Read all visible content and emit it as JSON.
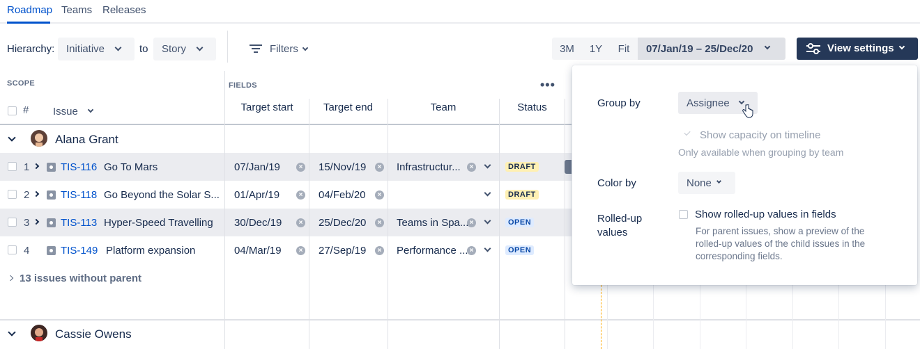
{
  "tabs": [
    {
      "label": "Roadmap",
      "active": true
    },
    {
      "label": "Teams",
      "active": false
    },
    {
      "label": "Releases",
      "active": false
    }
  ],
  "toolbar": {
    "hierarchy_label": "Hierarchy:",
    "from_value": "Initiative",
    "to_label": "to",
    "to_value": "Story",
    "filters_label": "Filters",
    "zoom_3m": "3M",
    "zoom_1y": "1Y",
    "zoom_fit": "Fit",
    "date_range": "07/Jan/19 – 25/Dec/20",
    "view_settings_label": "View settings"
  },
  "table": {
    "scope_caption": "SCOPE",
    "fields_caption": "FIELDS",
    "hash_header": "#",
    "issue_header": "Issue",
    "columns": [
      "Target start",
      "Target end",
      "Team",
      "Status"
    ],
    "groups": [
      {
        "name": "Alana Grant",
        "rows": [
          {
            "num": "1",
            "key": "TIS-116",
            "summary": "Go To Mars",
            "start": "07/Jan/19",
            "end": "15/Nov/19",
            "team": "Infrastructur...",
            "status": "DRAFT"
          },
          {
            "num": "2",
            "key": "TIS-118",
            "summary": "Go Beyond the Solar S...",
            "start": "01/Apr/19",
            "end": "04/Feb/20",
            "team": "",
            "status": "DRAFT"
          },
          {
            "num": "3",
            "key": "TIS-113",
            "summary": "Hyper-Speed Travelling",
            "start": "30/Dec/19",
            "end": "25/Dec/20",
            "team": "Teams in Spa...",
            "status": "OPEN"
          },
          {
            "num": "4",
            "key": "TIS-149",
            "summary": "Platform expansion",
            "start": "04/Mar/19",
            "end": "27/Sep/19",
            "team": "Performance ...",
            "status": "OPEN"
          }
        ],
        "without_parent": "13 issues without parent"
      },
      {
        "name": "Cassie Owens"
      }
    ]
  },
  "view_settings": {
    "group_by_label": "Group by",
    "group_by_value": "Assignee",
    "show_capacity_label": "Show capacity on timeline",
    "capacity_note": "Only available when grouping by team",
    "color_by_label": "Color by",
    "color_by_value": "None",
    "rolled_up_label_1": "Rolled-up",
    "rolled_up_label_2": "values",
    "rolled_up_checkbox_label": "Show rolled-up values in fields",
    "rolled_up_help": "For parent issues, show a preview of the rolled-up values of the child issues in the corresponding fields."
  },
  "colors": {
    "brand_blue": "#0052cc",
    "primary_button": "#253858",
    "today_marker": "#ffab00"
  }
}
